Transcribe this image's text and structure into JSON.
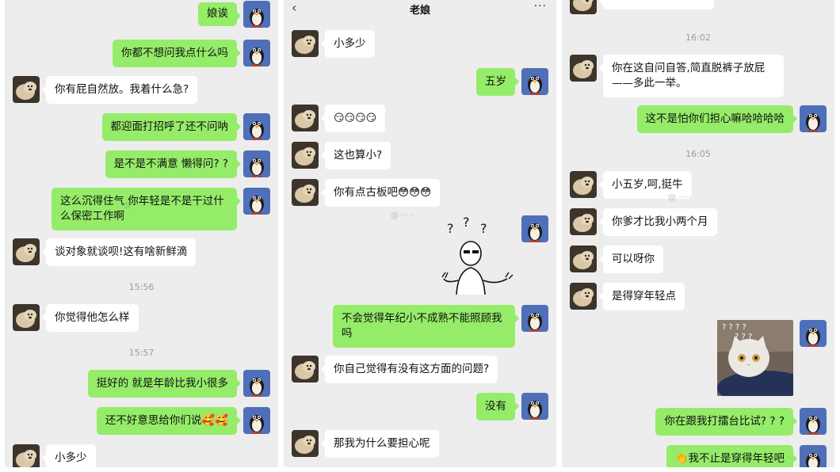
{
  "panel1": {
    "messages": [
      {
        "side": "right",
        "text": "娘诶"
      },
      {
        "side": "right",
        "text": "你都不想问我点什么吗"
      },
      {
        "side": "left",
        "text": "你有屁自然放。我着什么急?"
      },
      {
        "side": "right",
        "text": "都迎面打招呼了还不问呐"
      },
      {
        "side": "right",
        "text": "是不是不满意 懒得问? ?"
      },
      {
        "side": "right",
        "text": "这么沉得住气 你年轻是不是干过什么保密工作啊"
      },
      {
        "side": "left",
        "text": "谈对象就谈呗!这有啥新鲜滴"
      },
      {
        "side": "time",
        "text": "15:56"
      },
      {
        "side": "left",
        "text": "你觉得他怎么样"
      },
      {
        "side": "time",
        "text": "15:57"
      },
      {
        "side": "right",
        "text": "挺好的 就是年龄比我小很多"
      },
      {
        "side": "right",
        "text": "还不好意思给你们说🥰🥰"
      },
      {
        "side": "left",
        "text": "小多少"
      }
    ]
  },
  "panel2": {
    "header": {
      "back": "‹",
      "title": "老娘",
      "more": "···"
    },
    "messages": [
      {
        "side": "left",
        "text": "小多少"
      },
      {
        "side": "right",
        "text": "五岁"
      },
      {
        "side": "left",
        "text": "😏😏😏😏"
      },
      {
        "side": "left",
        "text": "这也算小?"
      },
      {
        "side": "left",
        "text": "你有点古板吧😳😳😳"
      },
      {
        "side": "right",
        "text": "不会觉得年纪小不成熟不能照顾我吗"
      },
      {
        "side": "left",
        "text": "你自己觉得有没有这方面的问题?"
      },
      {
        "side": "right",
        "text": "没有"
      },
      {
        "side": "left",
        "text": "那我为什么要担心呢"
      }
    ]
  },
  "panel3": {
    "messages": [
      {
        "side": "time",
        "text": "16:02"
      },
      {
        "side": "left",
        "text": "你在这自问自答,简直脱裤子放屁——多此一举。"
      },
      {
        "side": "right",
        "text": "这不是怕你们担心嘛哈哈哈哈"
      },
      {
        "side": "time",
        "text": "16:05"
      },
      {
        "side": "left",
        "text": "小五岁,呵,挺牛"
      },
      {
        "side": "left",
        "text": "你爹才比我小两个月"
      },
      {
        "side": "left",
        "text": "可以呀你"
      },
      {
        "side": "left",
        "text": "是得穿年轻点"
      },
      {
        "side": "right",
        "text": "你在跟我打擂台比试? ? ?"
      },
      {
        "side": "right",
        "text": "👏我不止是穿得年轻吧"
      }
    ]
  },
  "colors": {
    "sent_bubble": "#95ec69",
    "received_bubble": "#ffffff",
    "background": "#ededed"
  }
}
